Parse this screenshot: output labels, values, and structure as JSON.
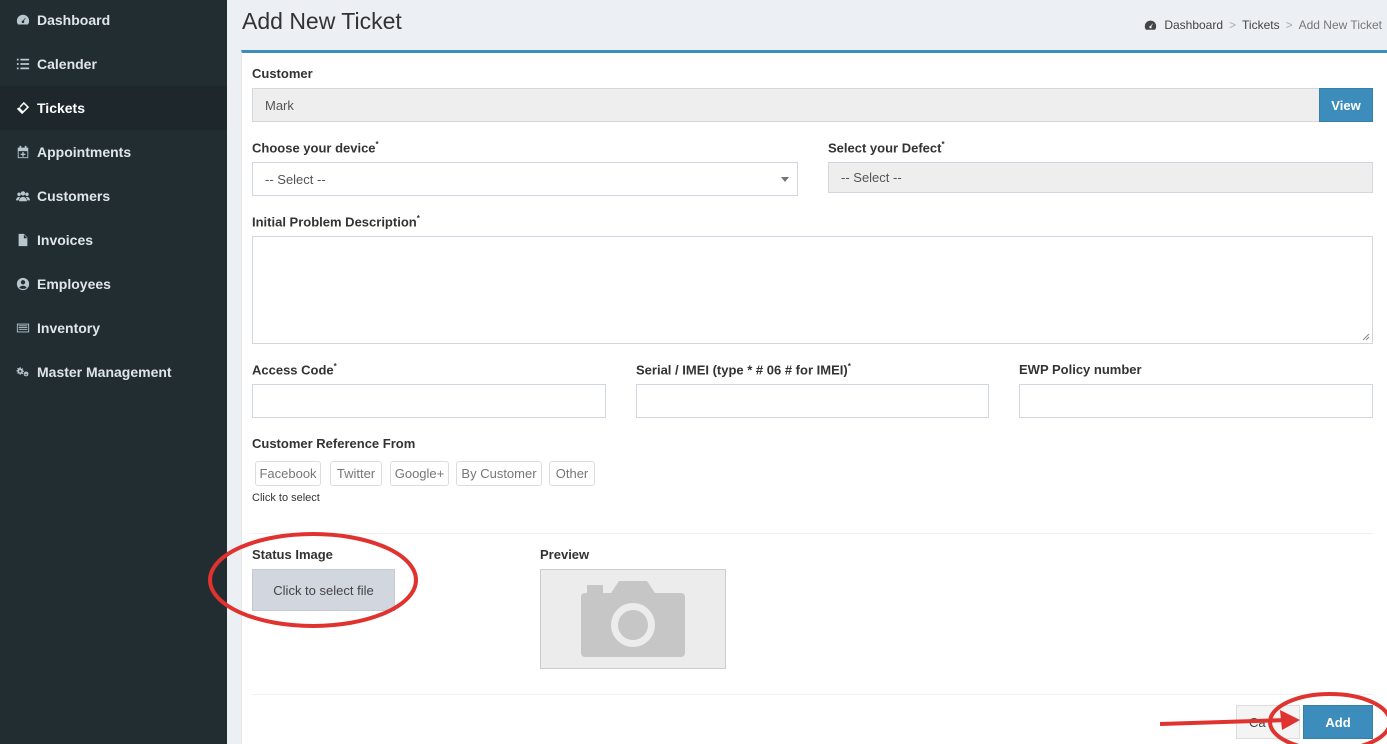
{
  "sidebar": {
    "items": [
      {
        "label": "Dashboard",
        "icon": "dashboard-icon"
      },
      {
        "label": "Calender",
        "icon": "list-icon"
      },
      {
        "label": "Tickets",
        "icon": "ticket-icon"
      },
      {
        "label": "Appointments",
        "icon": "calendar-plus-icon"
      },
      {
        "label": "Customers",
        "icon": "users-icon"
      },
      {
        "label": "Invoices",
        "icon": "file-icon"
      },
      {
        "label": "Employees",
        "icon": "user-circle-icon"
      },
      {
        "label": "Inventory",
        "icon": "inventory-icon"
      },
      {
        "label": "Master Management",
        "icon": "gears-icon"
      }
    ],
    "active": "Tickets"
  },
  "header": {
    "title": "Add New Ticket",
    "breadcrumb": [
      "Dashboard",
      "Tickets",
      "Add New Ticket"
    ],
    "separator": ">"
  },
  "form": {
    "customer_label": "Customer",
    "customer_value": "Mark",
    "view_button": "View",
    "device_label": "Choose your device",
    "device_value": "-- Select --",
    "defect_label": "Select your Defect",
    "defect_value": "-- Select --",
    "problem_label": "Initial Problem Description",
    "access_code_label": "Access Code",
    "serial_label": "Serial / IMEI (type * # 06 # for IMEI)",
    "ewp_label": "EWP Policy number",
    "required_mark": "*",
    "reference_label": "Customer Reference From",
    "reference_options": [
      "Facebook",
      "Twitter",
      "Google+",
      "By Customer",
      "Other"
    ],
    "reference_hint": "Click to select",
    "status_image_label": "Status Image",
    "select_file_button": "Click to select file",
    "preview_label": "Preview",
    "cancel_button": "Ca",
    "add_button": "Add"
  },
  "colors": {
    "sidebar_bg": "#222d32",
    "primary": "#3c8dbc",
    "annotation": "#e0322e"
  }
}
